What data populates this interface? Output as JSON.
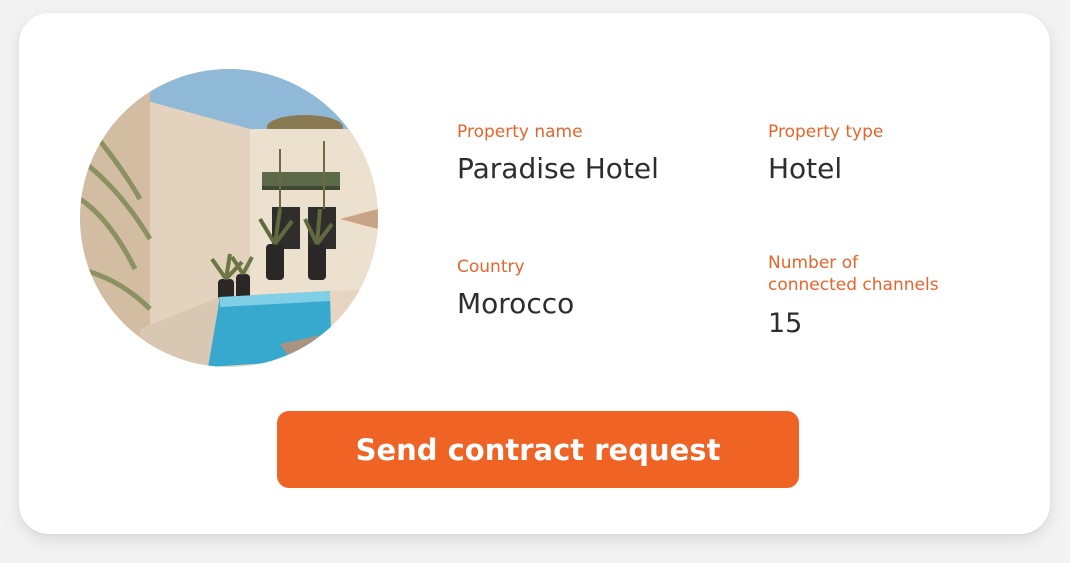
{
  "property": {
    "photo_icon": "hotel-courtyard-pool-photo",
    "name_label": "Property name",
    "name_value": "Paradise Hotel",
    "type_label": "Property type",
    "type_value": "Hotel",
    "country_label": "Country",
    "country_value": "Morocco",
    "channels_label": "Number of\nconnected channels",
    "channels_value": "15"
  },
  "actions": {
    "send_label": "Send contract request"
  },
  "colors": {
    "accent": "#ef6324",
    "label": "#e8642a",
    "text": "#2e2e2e",
    "card": "#ffffff",
    "background": "#f3f3f3"
  }
}
